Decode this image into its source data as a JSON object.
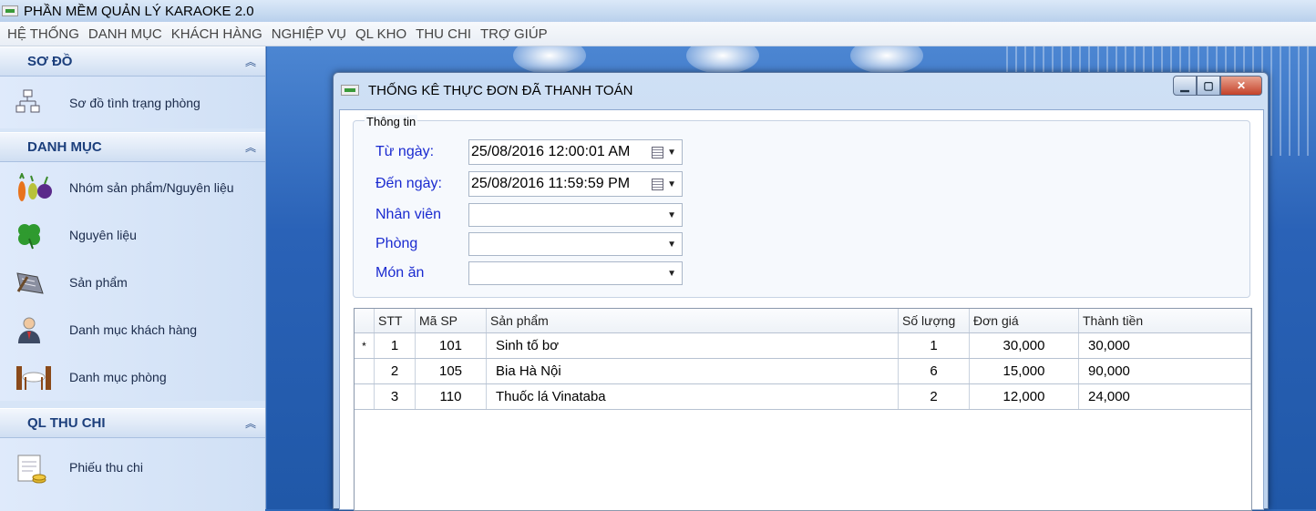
{
  "app": {
    "title": "PHẦN MỀM QUẢN LÝ KARAOKE 2.0"
  },
  "menu": [
    "HỆ THỐNG",
    "DANH MỤC",
    "KHÁCH HÀNG",
    "NGHIỆP VỤ",
    "QL KHO",
    "THU CHI",
    "TRỢ GIÚP"
  ],
  "sidebar": {
    "groups": [
      {
        "title": "SƠ ĐỒ",
        "items": [
          {
            "label": "Sơ đồ tình trạng phòng",
            "icon": "room-status-diagram-icon"
          }
        ]
      },
      {
        "title": "DANH MỤC",
        "items": [
          {
            "label": "Nhóm sản phẩm/Nguyên liệu",
            "icon": "vegetables-icon"
          },
          {
            "label": "Nguyên liệu",
            "icon": "clover-icon"
          },
          {
            "label": "Sản phẩm",
            "icon": "product-icon"
          },
          {
            "label": "Danh mục khách hàng",
            "icon": "customer-icon"
          },
          {
            "label": "Danh mục phòng",
            "icon": "dining-table-icon"
          }
        ]
      },
      {
        "title": "QL THU CHI",
        "items": [
          {
            "label": "Phiếu thu chi",
            "icon": "receipt-icon"
          }
        ]
      }
    ]
  },
  "dialog": {
    "title": "THỐNG KÊ THỰC ĐƠN ĐÃ THANH TOÁN",
    "group_title": "Thông tin",
    "fields": {
      "from": {
        "label": "Từ ngày:",
        "value": "25/08/2016 12:00:01 AM"
      },
      "to": {
        "label": "Đến ngày:",
        "value": "25/08/2016 11:59:59 PM"
      },
      "staff": {
        "label": "Nhân viên",
        "value": ""
      },
      "room": {
        "label": "Phòng",
        "value": ""
      },
      "dish": {
        "label": "Món ăn",
        "value": ""
      }
    },
    "grid": {
      "columns": [
        "STT",
        "Mã SP",
        "Sản phẩm",
        "Số lượng",
        "Đơn giá",
        "Thành tiền"
      ],
      "rows": [
        {
          "marker": "*",
          "stt": "1",
          "code": "101",
          "product": "Sinh tố bơ",
          "qty": "1",
          "price": "30,000",
          "total": "30,000"
        },
        {
          "marker": "",
          "stt": "2",
          "code": "105",
          "product": "Bia Hà Nội",
          "qty": "6",
          "price": "15,000",
          "total": "90,000"
        },
        {
          "marker": "",
          "stt": "3",
          "code": "110",
          "product": "Thuốc lá Vinataba",
          "qty": "2",
          "price": "12,000",
          "total": "24,000"
        }
      ]
    }
  }
}
